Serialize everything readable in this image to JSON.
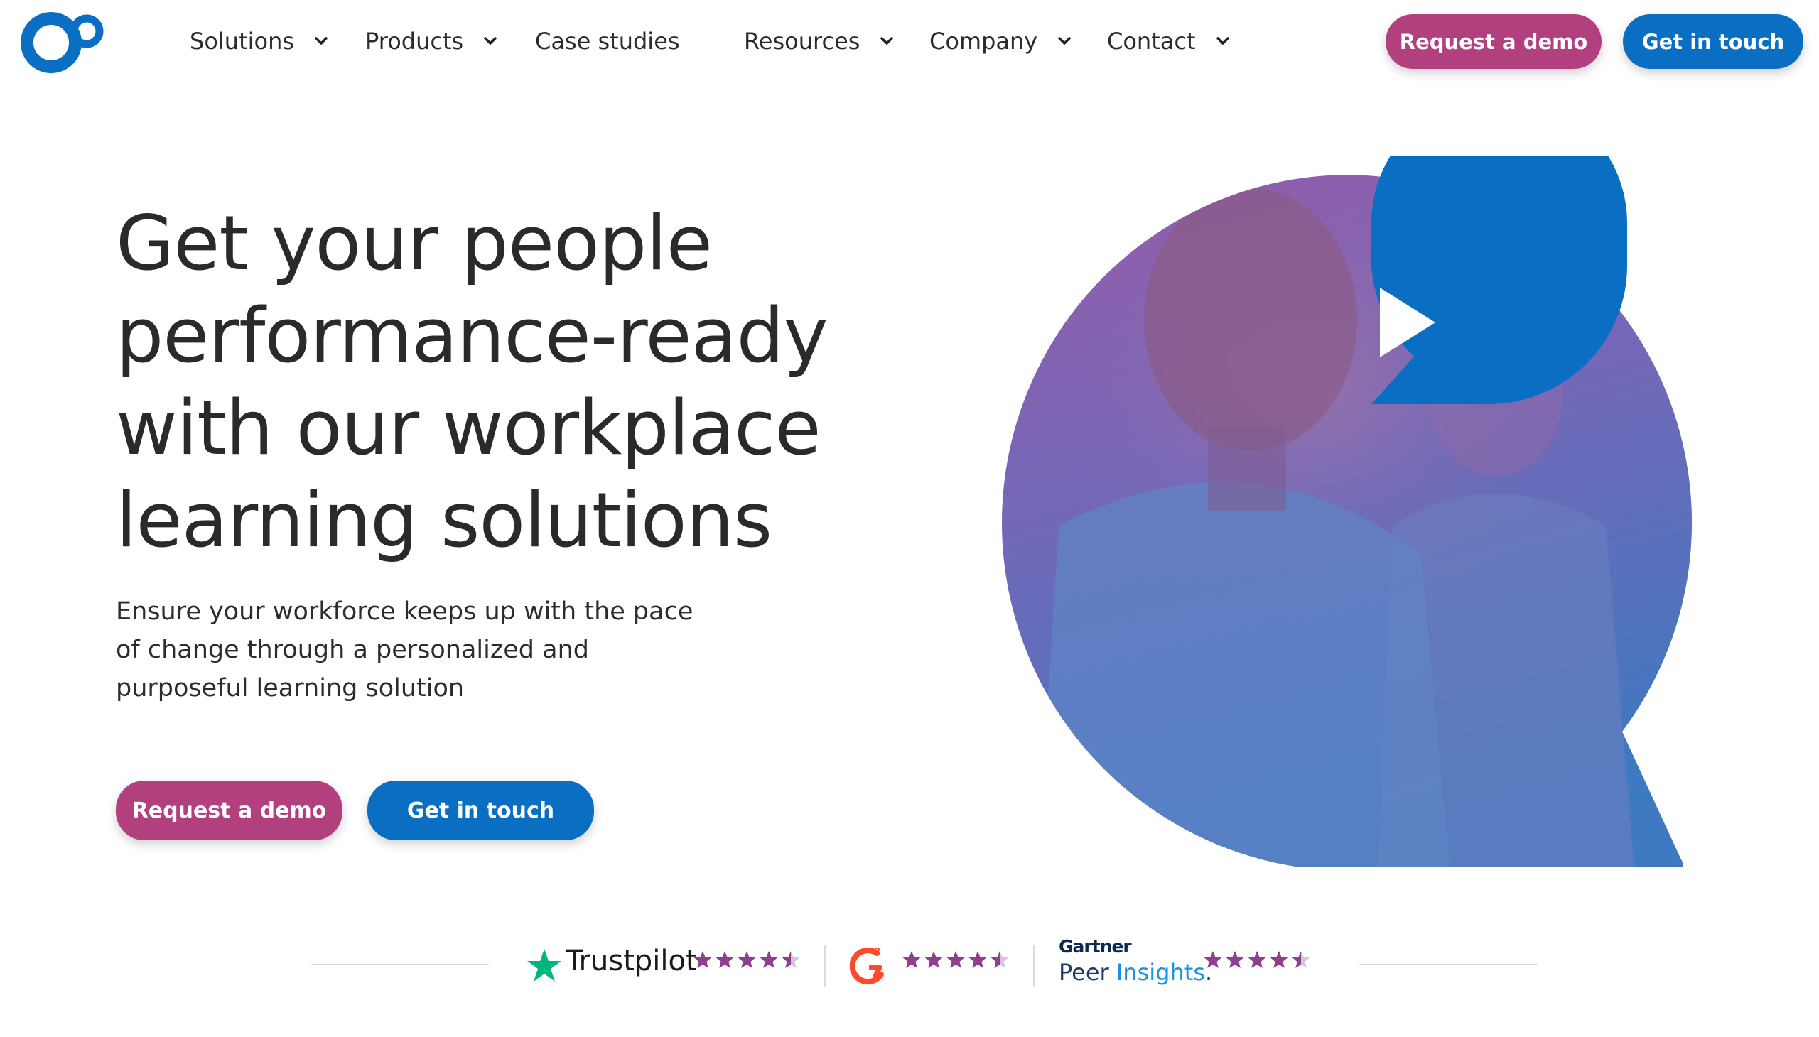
{
  "nav": {
    "items": [
      {
        "label": "Solutions",
        "dropdown": true
      },
      {
        "label": "Products",
        "dropdown": true
      },
      {
        "label": "Case studies",
        "dropdown": false
      },
      {
        "label": "Resources",
        "dropdown": true
      },
      {
        "label": "Company",
        "dropdown": true
      },
      {
        "label": "Contact",
        "dropdown": true
      }
    ],
    "request_demo": "Request a demo",
    "get_in_touch": "Get in touch"
  },
  "hero": {
    "title_lines": [
      "Get your people",
      "performance-ready",
      "with our workplace",
      "learning solutions"
    ],
    "subtitle_lines": [
      "Ensure your workforce keeps up with the pace",
      "of change through a personalized and",
      "purposeful learning solution"
    ],
    "request_demo": "Request a demo",
    "get_in_touch": "Get in touch",
    "video_icon": "play-icon"
  },
  "ratings": {
    "trustpilot": {
      "name": "Trustpilot",
      "stars": 4.5
    },
    "g2": {
      "name": "G2",
      "superscript": "2",
      "stars": 4.5
    },
    "gartner": {
      "top": "Gartner",
      "peer": "Peer",
      "insights": "Insights",
      "mark": ".",
      "stars": 4.5
    }
  },
  "colors": {
    "brand_blue": "#0a6fc2",
    "brand_pink": "#b2407f",
    "star_purple": "#8f3f8d",
    "trustpilot_green": "#00b67a",
    "g2_red": "#ff492c"
  }
}
